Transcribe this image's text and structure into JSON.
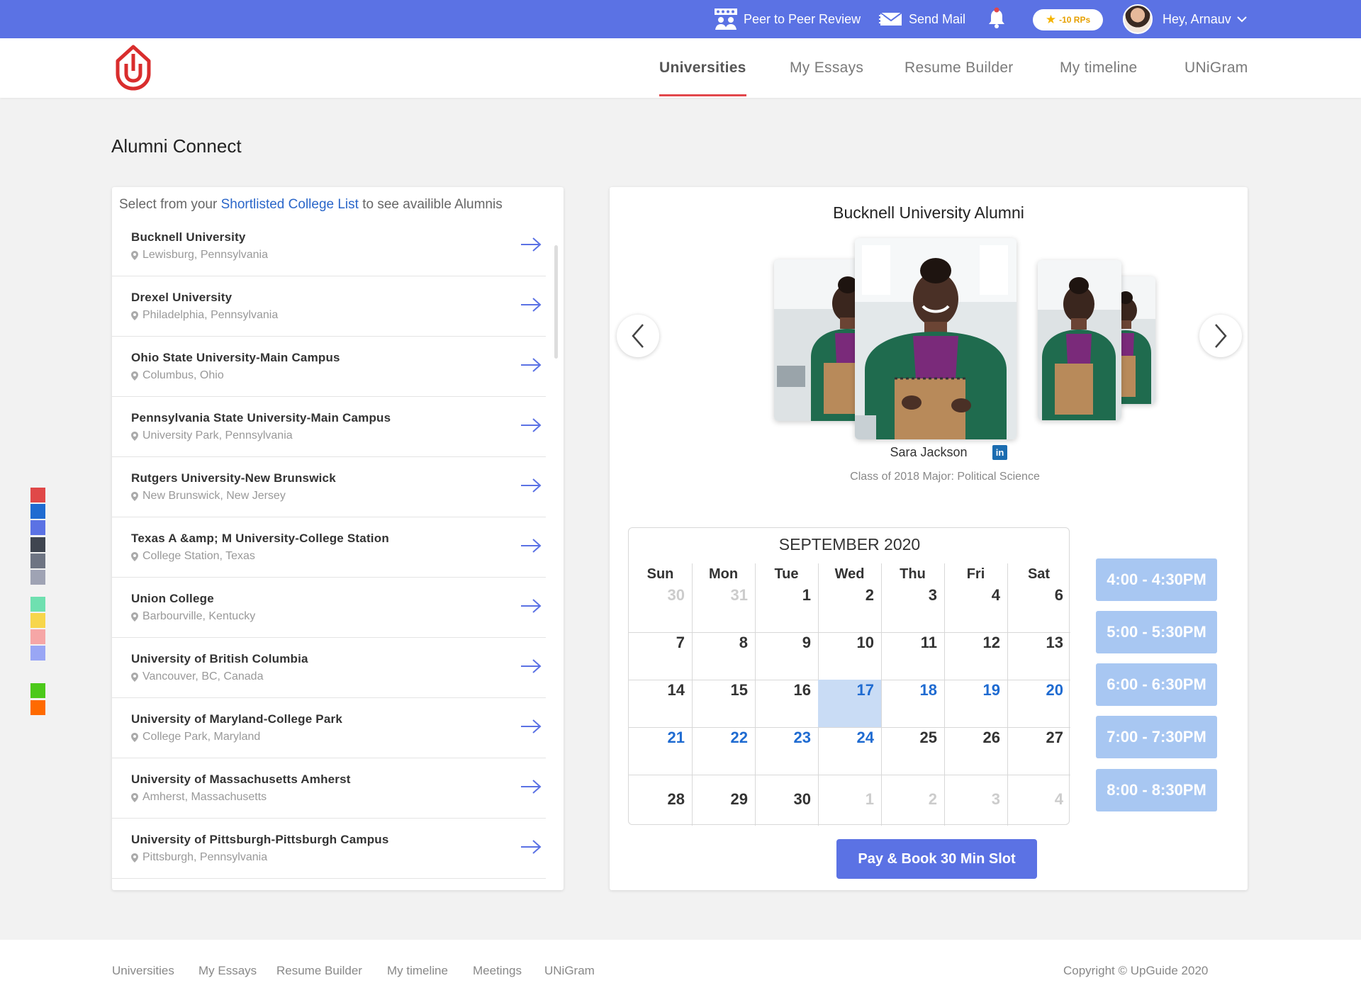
{
  "topbar": {
    "peer_review": "Peer to Peer Review",
    "send_mail": "Send Mail",
    "rp_badge": "-10 RPs",
    "greeting": "Hey, Arnauv"
  },
  "nav": {
    "items": [
      "Universities",
      "My Essays",
      "Resume Builder",
      "My timeline",
      "UNiGram"
    ],
    "active": "Universities"
  },
  "page_title": "Alumni Connect",
  "swatches": [
    "#e04848",
    "#1f6bd1",
    "#5b72e4",
    "#3f4550",
    "#6e7483",
    "#9fa3b4",
    "#6fe0b0",
    "#f7d64b",
    "#f6a6a6",
    "#99a6f5",
    "#4cc91a",
    "#ff6a00"
  ],
  "left_panel": {
    "intro_before": "Select from your ",
    "intro_link": "Shortlisted College List",
    "intro_after": " to see availible Alumnis",
    "universities": [
      {
        "name": "Bucknell University",
        "location": "Lewisburg, Pennsylvania"
      },
      {
        "name": "Drexel University",
        "location": "Philadelphia, Pennsylvania"
      },
      {
        "name": "Ohio State University-Main Campus",
        "location": "Columbus, Ohio"
      },
      {
        "name": "Pennsylvania State University-Main Campus",
        "location": "University Park, Pennsylvania"
      },
      {
        "name": "Rutgers University-New Brunswick",
        "location": "New Brunswick, New Jersey"
      },
      {
        "name": "Texas A &amp; M University-College Station",
        "location": "College Station, Texas"
      },
      {
        "name": "Union College",
        "location": "Barbourville, Kentucky"
      },
      {
        "name": "University of British Columbia",
        "location": "Vancouver, BC, Canada"
      },
      {
        "name": "University of Maryland-College Park",
        "location": "College Park, Maryland"
      },
      {
        "name": "University of Massachusetts Amherst",
        "location": "Amherst, Massachusetts"
      },
      {
        "name": "University of Pittsburgh-Pittsburgh Campus",
        "location": "Pittsburgh, Pennsylvania"
      }
    ]
  },
  "right_panel": {
    "title": "Bucknell University Alumni",
    "alumni_name": "Sara Jackson",
    "linkedin_label": "in",
    "alumni_details": "Class of 2018 Major: Political Science",
    "calendar": {
      "month": "SEPTEMBER 2020",
      "days": [
        "Sun",
        "Mon",
        "Tue",
        "Wed",
        "Thu",
        "Fri",
        "Sat"
      ],
      "weeks": [
        [
          {
            "d": "30",
            "s": "muted"
          },
          {
            "d": "31",
            "s": "muted"
          },
          {
            "d": "1",
            "s": "normal"
          },
          {
            "d": "2",
            "s": "normal"
          },
          {
            "d": "3",
            "s": "normal"
          },
          {
            "d": "4",
            "s": "normal"
          },
          {
            "d": "6",
            "s": "normal"
          }
        ],
        [
          {
            "d": "7",
            "s": "normal"
          },
          {
            "d": "8",
            "s": "normal"
          },
          {
            "d": "9",
            "s": "normal"
          },
          {
            "d": "10",
            "s": "normal"
          },
          {
            "d": "11",
            "s": "normal"
          },
          {
            "d": "12",
            "s": "normal"
          },
          {
            "d": "13",
            "s": "normal"
          }
        ],
        [
          {
            "d": "14",
            "s": "normal"
          },
          {
            "d": "15",
            "s": "normal"
          },
          {
            "d": "16",
            "s": "normal"
          },
          {
            "d": "17",
            "s": "selected"
          },
          {
            "d": "18",
            "s": "available"
          },
          {
            "d": "19",
            "s": "available"
          },
          {
            "d": "20",
            "s": "available"
          }
        ],
        [
          {
            "d": "21",
            "s": "available"
          },
          {
            "d": "22",
            "s": "available"
          },
          {
            "d": "23",
            "s": "available"
          },
          {
            "d": "24",
            "s": "available"
          },
          {
            "d": "25",
            "s": "normal"
          },
          {
            "d": "26",
            "s": "normal"
          },
          {
            "d": "27",
            "s": "normal"
          }
        ],
        [
          {
            "d": "28",
            "s": "normal"
          },
          {
            "d": "29",
            "s": "normal"
          },
          {
            "d": "30",
            "s": "normal"
          },
          {
            "d": "1",
            "s": "muted"
          },
          {
            "d": "2",
            "s": "muted"
          },
          {
            "d": "3",
            "s": "muted"
          },
          {
            "d": "4",
            "s": "muted"
          }
        ]
      ]
    },
    "time_slots": [
      "4:00 - 4:30PM",
      "5:00 - 5:30PM",
      "6:00 - 6:30PM",
      "7:00 - 7:30PM",
      "8:00 - 8:30PM"
    ],
    "book_button": "Pay & Book 30 Min Slot"
  },
  "footer": {
    "links": [
      "Universities",
      "My Essays",
      "Resume Builder",
      "My timeline",
      "Meetings",
      "UNiGram"
    ],
    "copyright": "Copyright © UpGuide 2020"
  },
  "colors": {
    "primary": "#5b72e4",
    "accent_red": "#e2474b",
    "link_blue": "#2a66c9",
    "slot_blue": "#a8c7f2",
    "selected_day_bg": "#c9dcf5",
    "available_day": "#1f6bd1"
  }
}
